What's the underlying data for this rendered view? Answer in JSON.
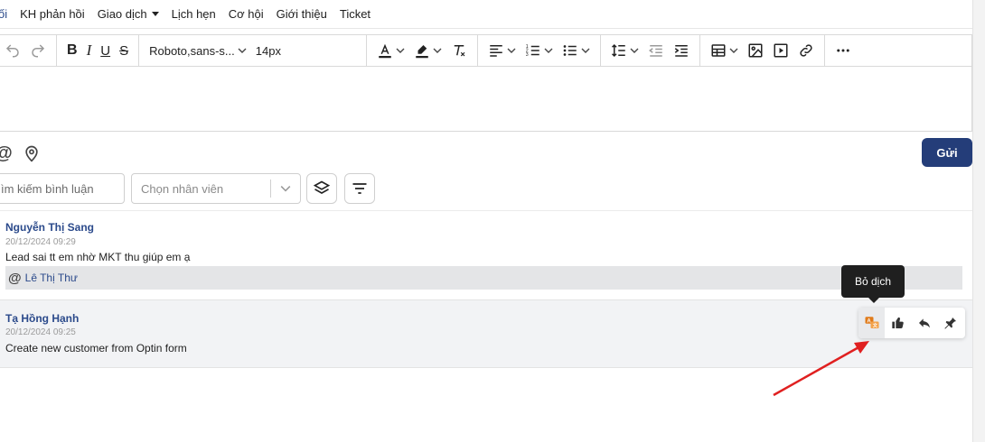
{
  "tabs": [
    {
      "label": "ối",
      "active": true
    },
    {
      "label": "KH phản hồi"
    },
    {
      "label": "Giao dịch",
      "has_dropdown": true
    },
    {
      "label": "Lịch hẹn"
    },
    {
      "label": "Cơ hội"
    },
    {
      "label": "Giới thiệu"
    },
    {
      "label": "Ticket"
    }
  ],
  "toolbar": {
    "font_family": "Roboto,sans-s...",
    "font_size": "14px",
    "icons": [
      "undo-icon",
      "redo-icon",
      "bold-icon",
      "italic-icon",
      "underline-icon",
      "strikethrough-icon",
      "text-color-icon",
      "highlight-icon",
      "clear-format-icon",
      "align-icon",
      "ordered-list-icon",
      "bullet-list-icon",
      "line-height-icon",
      "outdent-icon",
      "indent-icon",
      "table-icon",
      "image-icon",
      "video-icon",
      "link-icon",
      "more-icon"
    ]
  },
  "actions": {
    "send_label": "Gửi"
  },
  "filters": {
    "search_placeholder": "ìm kiếm bình luận",
    "staff_select_placeholder": "Chọn nhân viên"
  },
  "comments": [
    {
      "author": "Nguyễn Thị Sang",
      "date": "20/12/2024 09:29",
      "text": "Lead sai tt em nhờ MKT thu giúp em ạ",
      "mention": "Lê Thị Thư"
    },
    {
      "author": "Tạ Hồng Hạnh",
      "date": "20/12/2024 09:25",
      "text": "Create new customer from Optin form"
    }
  ],
  "tooltip": "Bỏ dịch",
  "colors": {
    "primary": "#243d79",
    "author": "#2b4a8b",
    "translate_icon": "#e07b1a",
    "annotation_arrow": "#e02020",
    "tooltip_bg": "#1f1f1f"
  }
}
